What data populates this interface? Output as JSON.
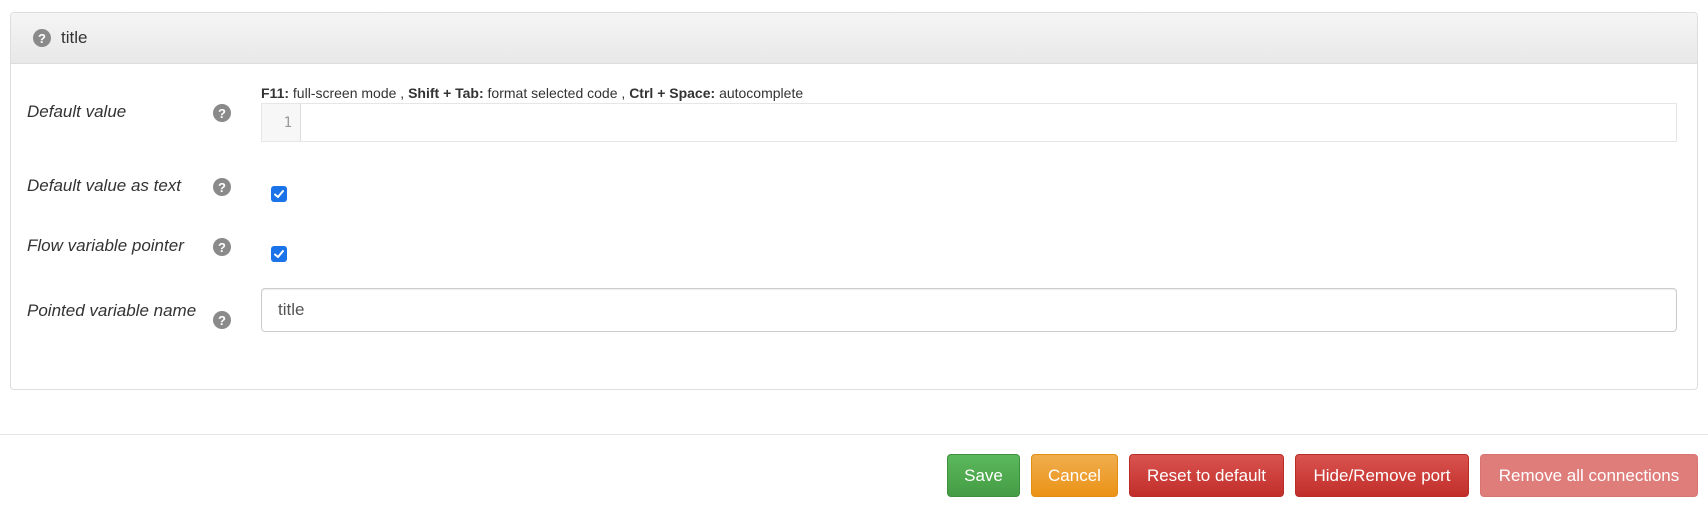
{
  "panel": {
    "title": "title"
  },
  "fields": {
    "default_value": {
      "label": "Default value",
      "hint": {
        "f11_key": "F11:",
        "f11_text": "full-screen mode ,",
        "shift_tab_key": "Shift + Tab:",
        "shift_tab_text": "format selected code ,",
        "ctrl_space_key": "Ctrl + Space:",
        "ctrl_space_text": "autocomplete"
      },
      "line_number": "1",
      "code": ""
    },
    "default_value_as_text": {
      "label": "Default value as text",
      "checked": true
    },
    "flow_variable_pointer": {
      "label": "Flow variable pointer",
      "checked": true
    },
    "pointed_variable_name": {
      "label": "Pointed variable name",
      "value": "title"
    }
  },
  "buttons": {
    "save": "Save",
    "cancel": "Cancel",
    "reset": "Reset to default",
    "hide_remove_port": "Hide/Remove port",
    "remove_all_connections": "Remove all connections"
  },
  "icons": {
    "help": "question-circle-icon",
    "check": "check-icon"
  },
  "colors": {
    "save": "#5cb85c",
    "cancel": "#f0ad4e",
    "danger": "#d9534f",
    "danger_disabled": "#df7d7b",
    "checkbox": "#1a73e8"
  }
}
